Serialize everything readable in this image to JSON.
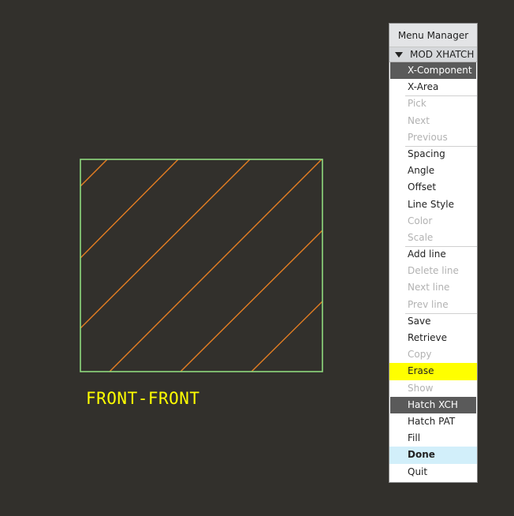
{
  "view_label": "FRONT-FRONT",
  "colors": {
    "background": "#32302c",
    "border_line": "#8ed97e",
    "hatch_line": "#e67e22",
    "label": "#ffff00"
  },
  "menu": {
    "title": "Menu Manager",
    "submenu": "MOD XHATCH",
    "items": [
      {
        "label": "X-Component",
        "style": "dark",
        "enabled": true,
        "sep": false
      },
      {
        "label": "X-Area",
        "style": "",
        "enabled": true,
        "sep": false
      },
      {
        "label": "Pick",
        "style": "",
        "enabled": false,
        "sep": true
      },
      {
        "label": "Next",
        "style": "",
        "enabled": false,
        "sep": false
      },
      {
        "label": "Previous",
        "style": "",
        "enabled": false,
        "sep": false
      },
      {
        "label": "Spacing",
        "style": "",
        "enabled": true,
        "sep": true
      },
      {
        "label": "Angle",
        "style": "",
        "enabled": true,
        "sep": false
      },
      {
        "label": "Offset",
        "style": "",
        "enabled": true,
        "sep": false
      },
      {
        "label": "Line Style",
        "style": "",
        "enabled": true,
        "sep": false
      },
      {
        "label": "Color",
        "style": "",
        "enabled": false,
        "sep": false
      },
      {
        "label": "Scale",
        "style": "",
        "enabled": false,
        "sep": false
      },
      {
        "label": "Add line",
        "style": "",
        "enabled": true,
        "sep": true
      },
      {
        "label": "Delete line",
        "style": "",
        "enabled": false,
        "sep": false
      },
      {
        "label": "Next line",
        "style": "",
        "enabled": false,
        "sep": false
      },
      {
        "label": "Prev line",
        "style": "",
        "enabled": false,
        "sep": false
      },
      {
        "label": "Save",
        "style": "",
        "enabled": true,
        "sep": true
      },
      {
        "label": "Retrieve",
        "style": "",
        "enabled": true,
        "sep": false
      },
      {
        "label": "Copy",
        "style": "",
        "enabled": false,
        "sep": false
      },
      {
        "label": "Erase",
        "style": "yellow",
        "enabled": true,
        "sep": false
      },
      {
        "label": "Show",
        "style": "",
        "enabled": false,
        "sep": false
      },
      {
        "label": "Hatch XCH",
        "style": "dark",
        "enabled": true,
        "sep": false
      },
      {
        "label": "Hatch PAT",
        "style": "",
        "enabled": true,
        "sep": false
      },
      {
        "label": "Fill",
        "style": "",
        "enabled": true,
        "sep": false
      },
      {
        "label": "Done",
        "style": "blue",
        "enabled": true,
        "sep": false
      },
      {
        "label": "Quit",
        "style": "",
        "enabled": true,
        "sep": false
      }
    ]
  }
}
